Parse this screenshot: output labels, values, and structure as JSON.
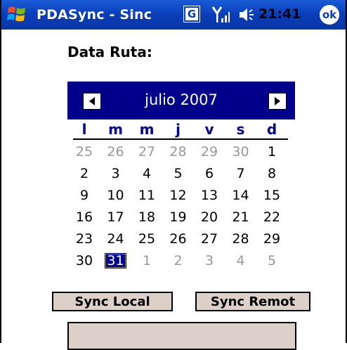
{
  "titlebar": {
    "title": "PDASync - Sinc",
    "g_icon_label": "G",
    "time": "21:41",
    "ok_label": "ok",
    "start_icon": "windows-flag-icon",
    "signal_icon": "signal-icon",
    "speaker_icon": "speaker-icon"
  },
  "form": {
    "date_label": "Data Ruta:"
  },
  "calendar": {
    "month_label": "julio 2007",
    "weekdays": [
      "l",
      "m",
      "m",
      "j",
      "v",
      "s",
      "d"
    ],
    "weeks": [
      [
        "25",
        "26",
        "27",
        "28",
        "29",
        "30",
        "1"
      ],
      [
        "2",
        "3",
        "4",
        "5",
        "6",
        "7",
        "8"
      ],
      [
        "9",
        "10",
        "11",
        "12",
        "13",
        "14",
        "15"
      ],
      [
        "16",
        "17",
        "18",
        "19",
        "20",
        "21",
        "22"
      ],
      [
        "23",
        "24",
        "25",
        "26",
        "27",
        "28",
        "29"
      ],
      [
        "30",
        "31",
        "1",
        "2",
        "3",
        "4",
        "5"
      ]
    ],
    "other_month_cells": [
      [
        0,
        0
      ],
      [
        0,
        1
      ],
      [
        0,
        2
      ],
      [
        0,
        3
      ],
      [
        0,
        4
      ],
      [
        0,
        5
      ],
      [
        5,
        2
      ],
      [
        5,
        3
      ],
      [
        5,
        4
      ],
      [
        5,
        5
      ],
      [
        5,
        6
      ]
    ],
    "selected_cell": [
      5,
      1
    ],
    "header_color": "#00008b"
  },
  "buttons": {
    "sync_local": "Sync Local",
    "sync_remote": "Sync Remot"
  }
}
